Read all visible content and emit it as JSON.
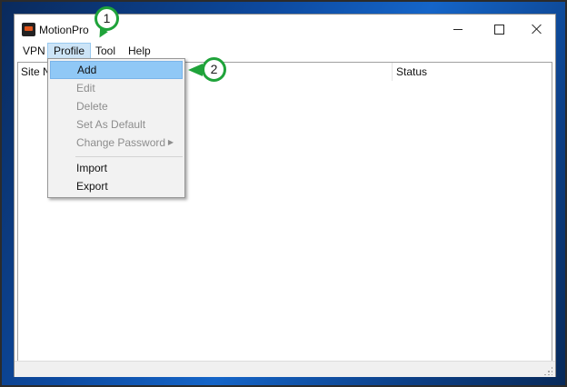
{
  "window": {
    "title": "MotionPro"
  },
  "menubar": {
    "items": [
      "VPN",
      "Profile",
      "Tool",
      "Help"
    ]
  },
  "list": {
    "columns": [
      "Site N",
      "Status"
    ]
  },
  "profile_menu": {
    "items": [
      {
        "label": "Add",
        "enabled": true,
        "highlighted": true
      },
      {
        "label": "Edit",
        "enabled": false
      },
      {
        "label": "Delete",
        "enabled": false
      },
      {
        "label": "Set As Default",
        "enabled": false
      },
      {
        "label": "Change Password",
        "enabled": false,
        "submenu": true
      },
      {
        "label": "Import",
        "enabled": true
      },
      {
        "label": "Export",
        "enabled": true
      }
    ]
  },
  "annotations": {
    "step1": "1",
    "step2": "2"
  },
  "colors": {
    "callout_green": "#1fa33a",
    "menu_highlight": "#90c8f6",
    "active_menu": "#cce4f7",
    "app_logo_accent": "#e0541b"
  }
}
